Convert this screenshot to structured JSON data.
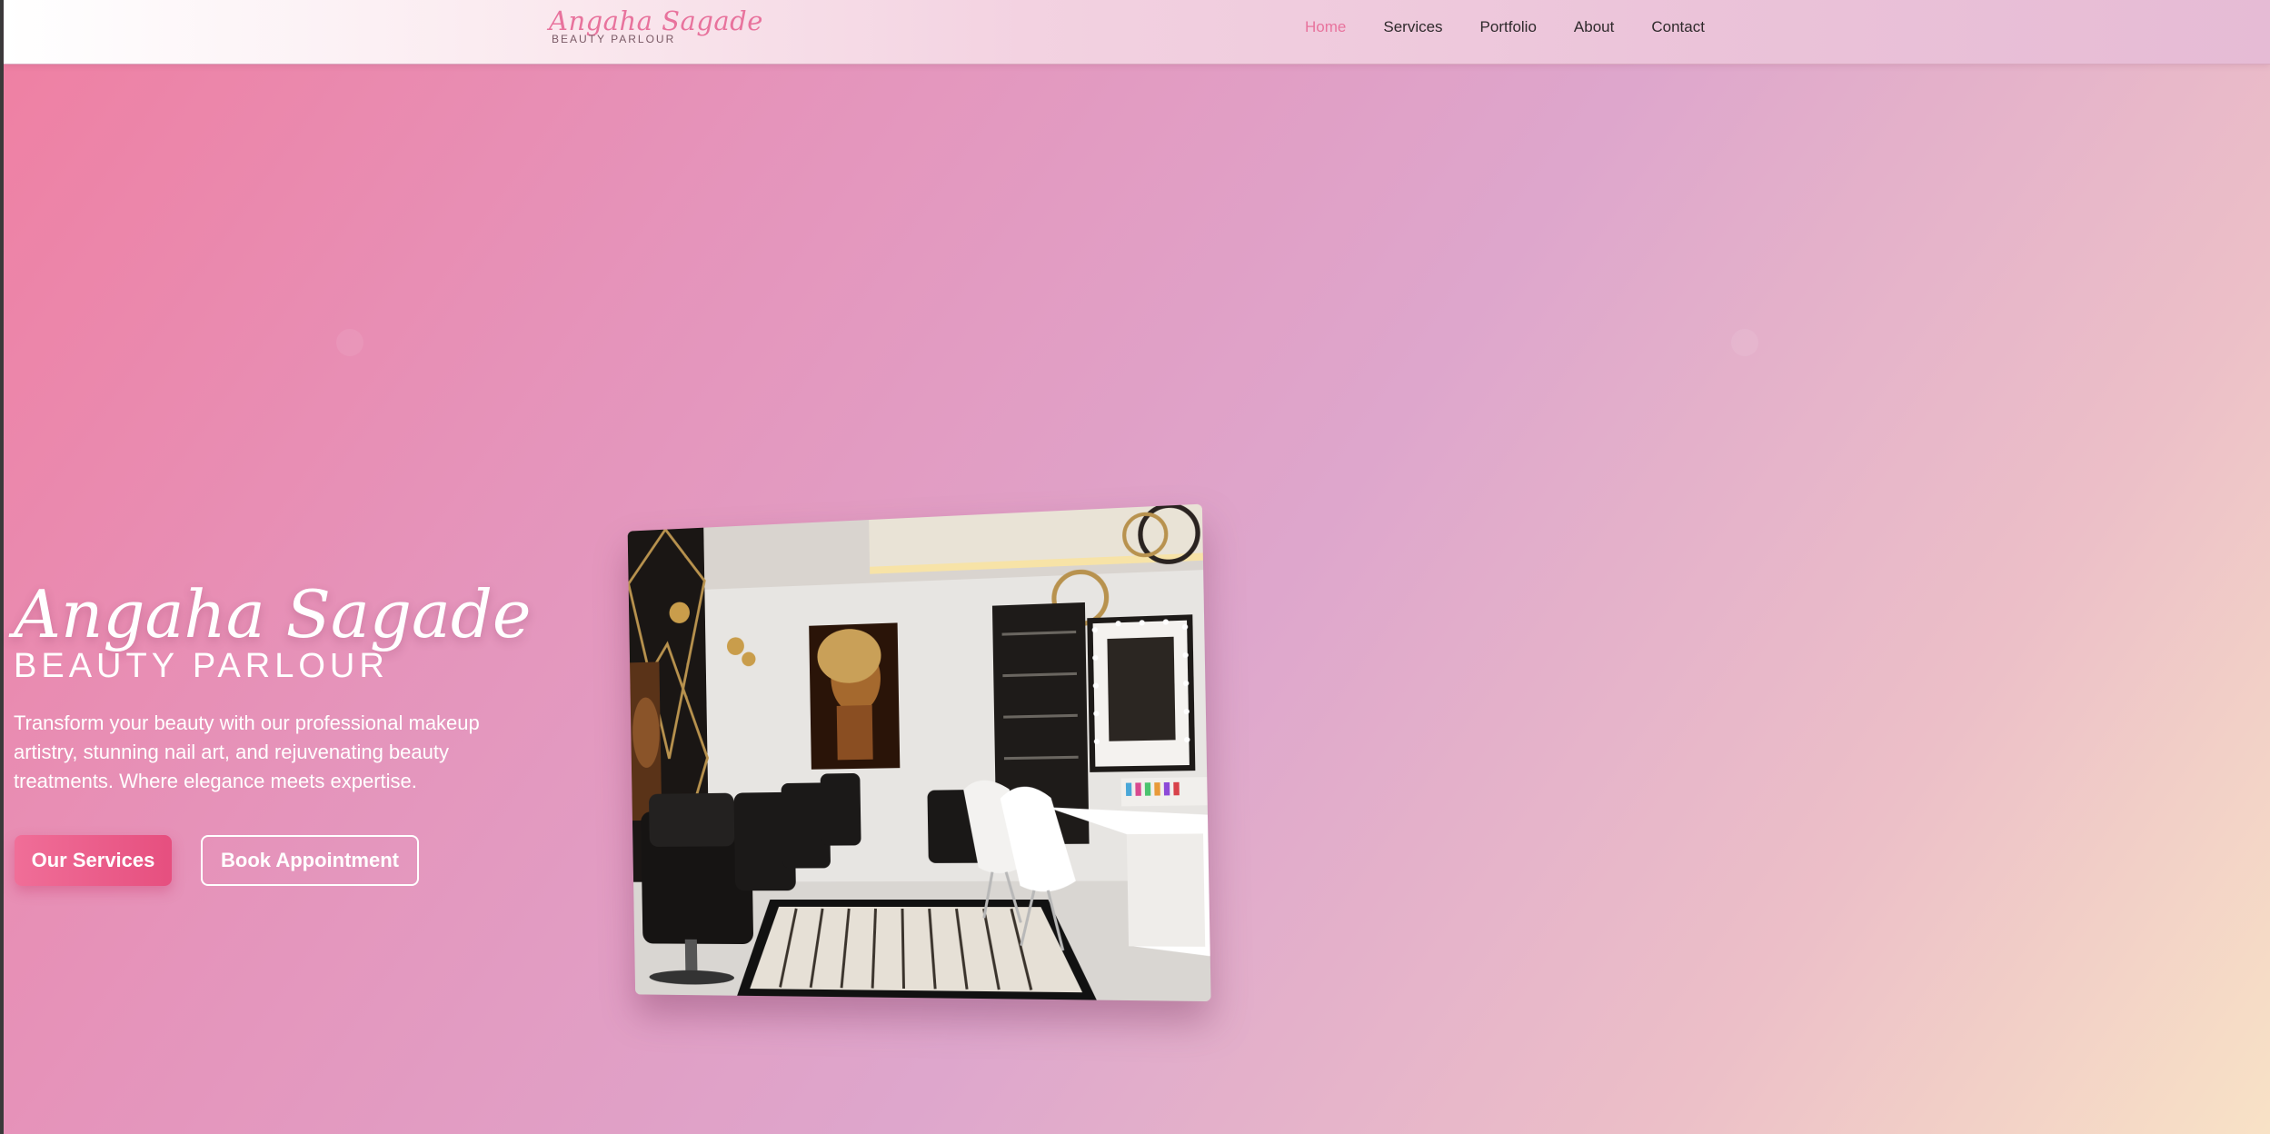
{
  "brand": {
    "name": "Angaha Sagade",
    "subtitle": "BEAUTY PARLOUR"
  },
  "nav": {
    "items": [
      {
        "label": "Home",
        "active": true
      },
      {
        "label": "Services",
        "active": false
      },
      {
        "label": "Portfolio",
        "active": false
      },
      {
        "label": "About",
        "active": false
      },
      {
        "label": "Contact",
        "active": false
      }
    ]
  },
  "hero": {
    "title": "Angaha Sagade",
    "subtitle": "BEAUTY PARLOUR",
    "description": "Transform your beauty with our professional makeup artistry, stunning nail art, and rejuvenating beauty treatments. Where elegance meets expertise.",
    "primary_button": "Our Services",
    "secondary_button": "Book Appointment"
  },
  "colors": {
    "accent": "#e8739d",
    "primary_button": "#ec5d8b",
    "text_light": "#ffffff",
    "nav_text": "#2f2a2c"
  }
}
